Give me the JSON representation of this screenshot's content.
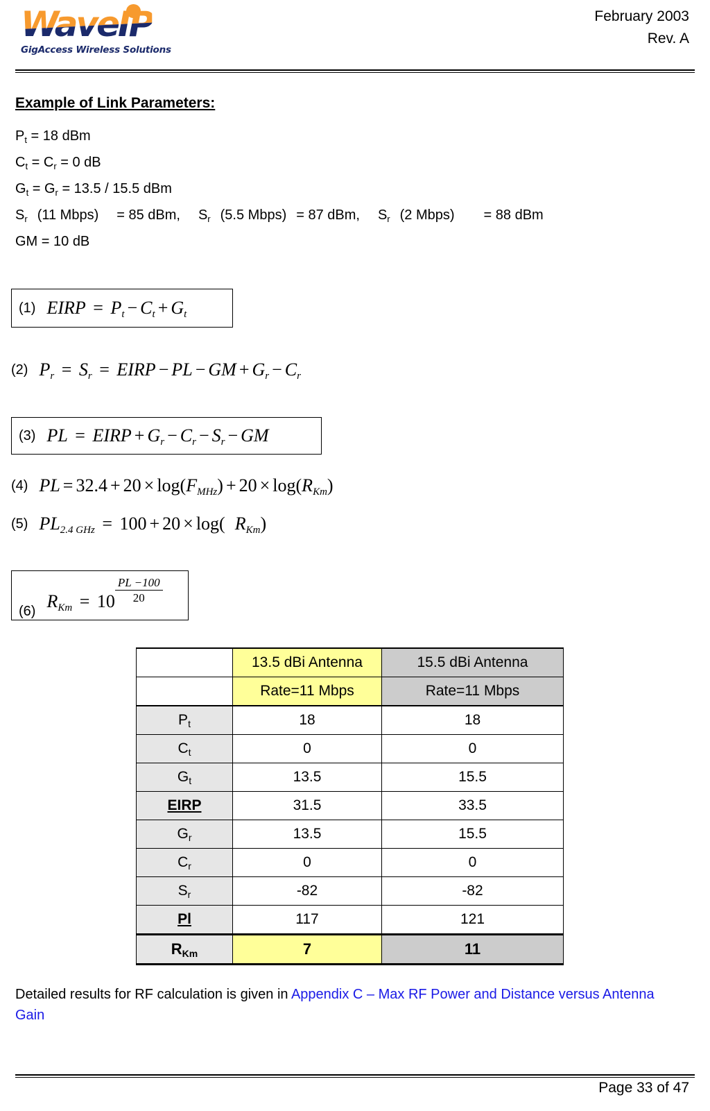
{
  "header": {
    "logo_word": "WaveIP",
    "logo_tagline": "GigAccess Wireless Solutions",
    "date": "February 2003",
    "revision": "Rev. A"
  },
  "body": {
    "section_title": "Example of Link Parameters:",
    "params": {
      "pt": {
        "sym": "P",
        "sub": "t",
        "rest": " = 18 dBm"
      },
      "ct": {
        "sym1": "C",
        "sub1": "t",
        "sym2": "C",
        "sub2": "r",
        "rest": " = 0 dB",
        "mid": " = "
      },
      "gt": {
        "sym1": "G",
        "sub1": "t",
        "sym2": "G",
        "sub2": "r",
        "mid": " = ",
        "rest": " = 13.5 / 15.5 dBm"
      },
      "sr": {
        "s1_sym": "S",
        "s1_sub": "r",
        "s1_rate": "(11 Mbps)",
        "s1_val": "= 85 dBm,",
        "s2_sym": "S",
        "s2_sub": "r",
        "s2_rate": "(5.5 Mbps)",
        "s2_val": "= 87 dBm,",
        "s3_sym": "S",
        "s3_sub": "r",
        "s3_rate": "(2 Mbps)",
        "s3_val": "= 88 dBm"
      },
      "gm": "GM = 10 dB"
    }
  },
  "equations": [
    {
      "num": "(1)",
      "lhs": "EIRP",
      "eq": " = ",
      "terms": [
        {
          "sym": "P",
          "sub": "t"
        },
        {
          "op": "−"
        },
        {
          "sym": "C",
          "sub": "t"
        },
        {
          "op": "+"
        },
        {
          "sym": "G",
          "sub": "t"
        }
      ],
      "boxed": true
    },
    {
      "num": "(2)",
      "lhs_sym": "P",
      "lhs_sub": "r",
      "eq": " = ",
      "mid_sym": "S",
      "mid_sub": "r",
      "eq2": " = ",
      "terms": [
        {
          "plain": "EIRP"
        },
        {
          "op": "−"
        },
        {
          "plain": "PL"
        },
        {
          "op": "−"
        },
        {
          "plain": "GM"
        },
        {
          "op": "+"
        },
        {
          "sym": "G",
          "sub": "r"
        },
        {
          "op": "−"
        },
        {
          "sym": "C",
          "sub": "r"
        }
      ],
      "boxed": false
    },
    {
      "num": "(3)",
      "lhs": "PL",
      "eq": " = ",
      "terms": [
        {
          "plain": "EIRP"
        },
        {
          "op": "+"
        },
        {
          "sym": "G",
          "sub": "r"
        },
        {
          "op": "−"
        },
        {
          "sym": "C",
          "sub": "r"
        },
        {
          "op": "−"
        },
        {
          "sym": "S",
          "sub": "r"
        },
        {
          "op": "−"
        },
        {
          "plain": "GM"
        }
      ],
      "boxed": true
    },
    {
      "num": "(4)",
      "text_lhs": "PL",
      "eq": "=",
      "const": "32.4",
      "plus1": "+",
      "coef1": "20",
      "times1": "×",
      "log1": "log(",
      "arg1_sym": "F",
      "arg1_sub": "MHz",
      "close1": ")",
      "plus2": "+",
      "coef2": "20",
      "times2": "×",
      "log2": "log(",
      "arg2_sym": "R",
      "arg2_sub": "Km",
      "close2": ")",
      "boxed": false
    },
    {
      "num": "(5)",
      "lhs_sym": "PL",
      "lhs_sub": "2.4 GHz",
      "eq": " = ",
      "const": "100",
      "plus": "+",
      "coef": "20",
      "times": "×",
      "log": "log(",
      "arg_sym": "R",
      "arg_sub": "Km",
      "close": ")",
      "boxed": false
    },
    {
      "num": "(6)",
      "lhs_sym": "R",
      "lhs_sub": "Km",
      "eq": " = ",
      "base": "10",
      "exp_num": "PL −100",
      "exp_den": "20",
      "boxed": true
    }
  ],
  "table": {
    "headers": {
      "corner": "",
      "col_a": "13.5 dBi Antenna",
      "col_b": "15.5 dBi Antenna"
    },
    "subheaders": {
      "corner": "",
      "col_a": "Rate=11 Mbps",
      "col_b": "Rate=11 Mbps"
    },
    "rows": [
      {
        "label_sym": "P",
        "label_sub": "t",
        "bold": false,
        "underline": false,
        "a": "18",
        "b": "18",
        "highlight": false
      },
      {
        "label_sym": "C",
        "label_sub": "t",
        "bold": false,
        "underline": false,
        "a": "0",
        "b": "0",
        "highlight": false
      },
      {
        "label_sym": "G",
        "label_sub": "t",
        "bold": false,
        "underline": false,
        "a": "13.5",
        "b": "15.5",
        "highlight": false
      },
      {
        "label_sym": "EIRP",
        "label_sub": "",
        "bold": true,
        "underline": true,
        "a": "31.5",
        "b": "33.5",
        "highlight": false
      },
      {
        "label_sym": "G",
        "label_sub": "r",
        "bold": false,
        "underline": false,
        "a": "13.5",
        "b": "15.5",
        "highlight": false
      },
      {
        "label_sym": "C",
        "label_sub": "r",
        "bold": false,
        "underline": false,
        "a": "0",
        "b": "0",
        "highlight": false
      },
      {
        "label_sym": "S",
        "label_sub": "r",
        "bold": false,
        "underline": false,
        "a": "-82",
        "b": "-82",
        "highlight": false
      },
      {
        "label_sym": "Pl",
        "label_sub": "",
        "bold": true,
        "underline": true,
        "a": "117",
        "b": "121",
        "highlight": false
      },
      {
        "label_sym": "R",
        "label_sub": "Km",
        "bold": true,
        "underline": false,
        "a": "7",
        "b": "11",
        "highlight": true
      }
    ]
  },
  "note": {
    "plain": "Detailed results for RF calculation is given in ",
    "link": "Appendix C – Max RF Power and Distance versus Antenna Gain"
  },
  "footer": {
    "page": "Page 33 of 47"
  },
  "colors": {
    "logo_orange": "#f79a2e",
    "logo_navy": "#1b2a6b",
    "highlight_yellow": "#ffff99",
    "highlight_gray": "#cccccc",
    "label_gray": "#e6e6e6",
    "link_blue": "#1a1ae6"
  }
}
